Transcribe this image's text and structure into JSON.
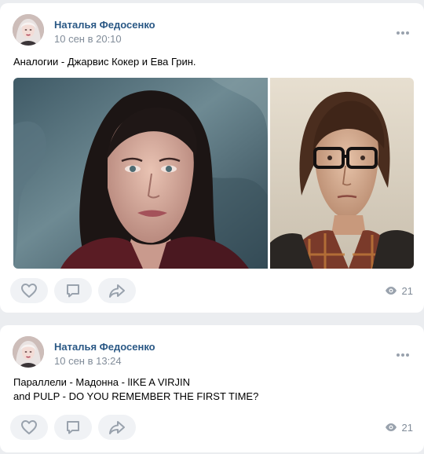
{
  "posts": [
    {
      "author": "Наталья Федосенко",
      "date": "10 сен в 20:10",
      "text_lines": [
        "Аналогии - Джарвис Кокер и Ева Грин."
      ],
      "photos": [
        "photo-portrait-woman",
        "photo-portrait-man-glasses"
      ],
      "views": "21"
    },
    {
      "author": "Наталья Федосенко",
      "date": "10 сен в 13:24",
      "text_lines": [
        "Параллели - Мадонна - lIKE A VIRJIN",
        "and PULP - DO YOU REMEMBER THE FIRST TIME?"
      ],
      "views": "21"
    }
  ],
  "icons": {
    "more": "more-horizontal-icon",
    "like": "heart-icon",
    "comment": "comment-icon",
    "share": "share-arrow-icon",
    "views": "eye-icon"
  },
  "colors": {
    "author": "#2a5885",
    "secondary": "#818c99",
    "background": "#ebedf0",
    "action_button": "#f0f2f5",
    "icon": "#99a2ad"
  }
}
